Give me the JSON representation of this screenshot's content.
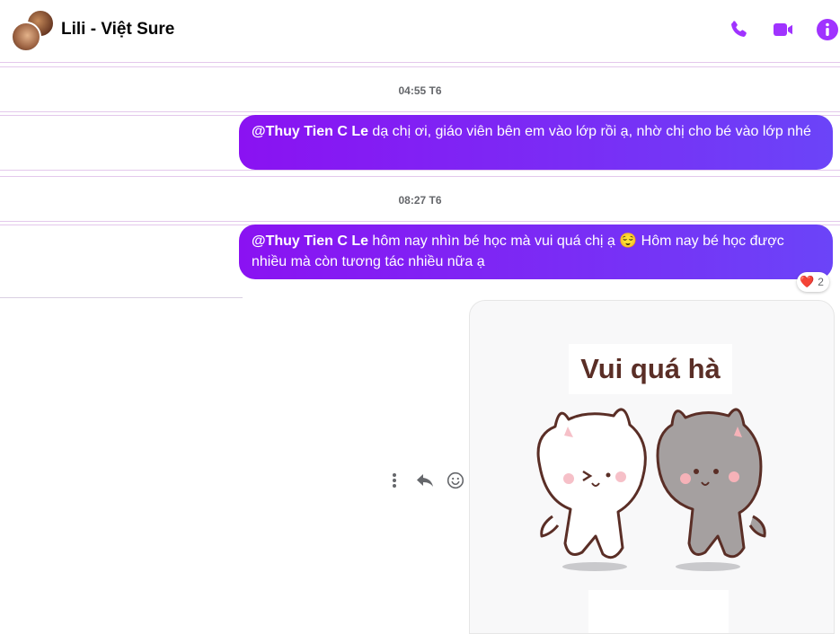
{
  "header": {
    "title": "Lili - Việt Sure",
    "icons": {
      "call": "phone-icon",
      "video": "video-icon",
      "info": "info-icon"
    },
    "accent": "#a033ff"
  },
  "messages": [
    {
      "time": "04:55 T6",
      "mention": "@Thuy Tien C Le",
      "text": " dạ chị ơi, giáo viên bên em vào lớp rồi ạ, nhờ chị cho bé vào lớp nhé"
    },
    {
      "time": "08:27 T6",
      "mention": "@Thuy Tien C Le",
      "text": " hôm nay nhìn bé học mà vui quá chị ạ 😌 Hôm nay bé học được nhiều mà còn tương tác nhiều nữa ạ",
      "reaction": {
        "emoji": "❤️",
        "count": "2"
      }
    }
  ],
  "sticker": {
    "caption": "Vui quá hà"
  },
  "message_actions": [
    "more-icon",
    "reply-icon",
    "emoji-icon"
  ],
  "colors": {
    "bubble_start": "#8a12f2",
    "bubble_end": "#6b44f8",
    "separator": "#e4c8ec"
  }
}
